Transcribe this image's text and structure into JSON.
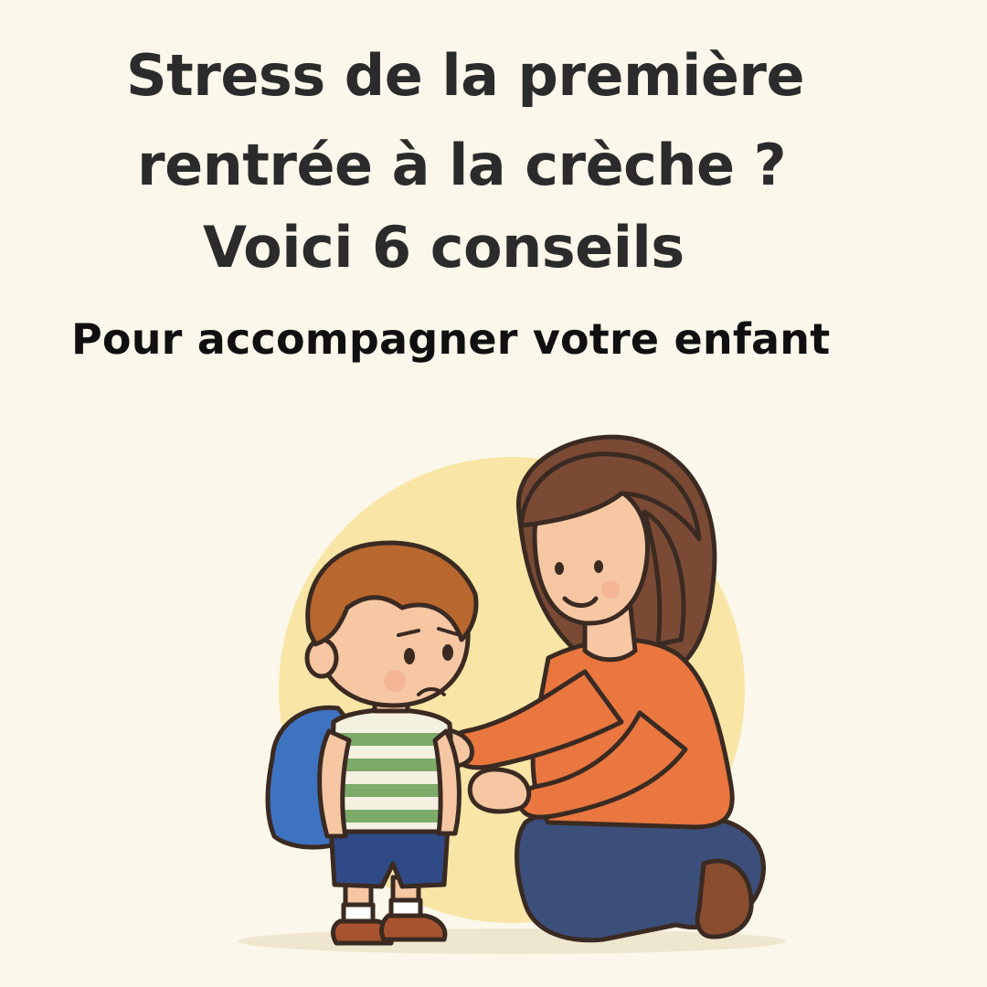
{
  "poster": {
    "title_line_1": "Stress de la première",
    "title_line_2": "rentrée à la crèche ?",
    "title_line_3": "Voici 6 conseils",
    "subtitle": "Pour accompagner votre enfant"
  },
  "colors": {
    "background": "#fbf7ea",
    "sun": "#f9e6a6",
    "title": "#2b2b2b",
    "subtitle": "#101010",
    "mother_sweater": "#e9773f",
    "mother_jeans": "#3b4f7a",
    "mother_hair": "#7a4a35",
    "child_hair": "#b8672f",
    "child_shirt_stripe_green": "#7cab6a",
    "backpack": "#3e73c2",
    "shorts": "#2f4a86"
  }
}
